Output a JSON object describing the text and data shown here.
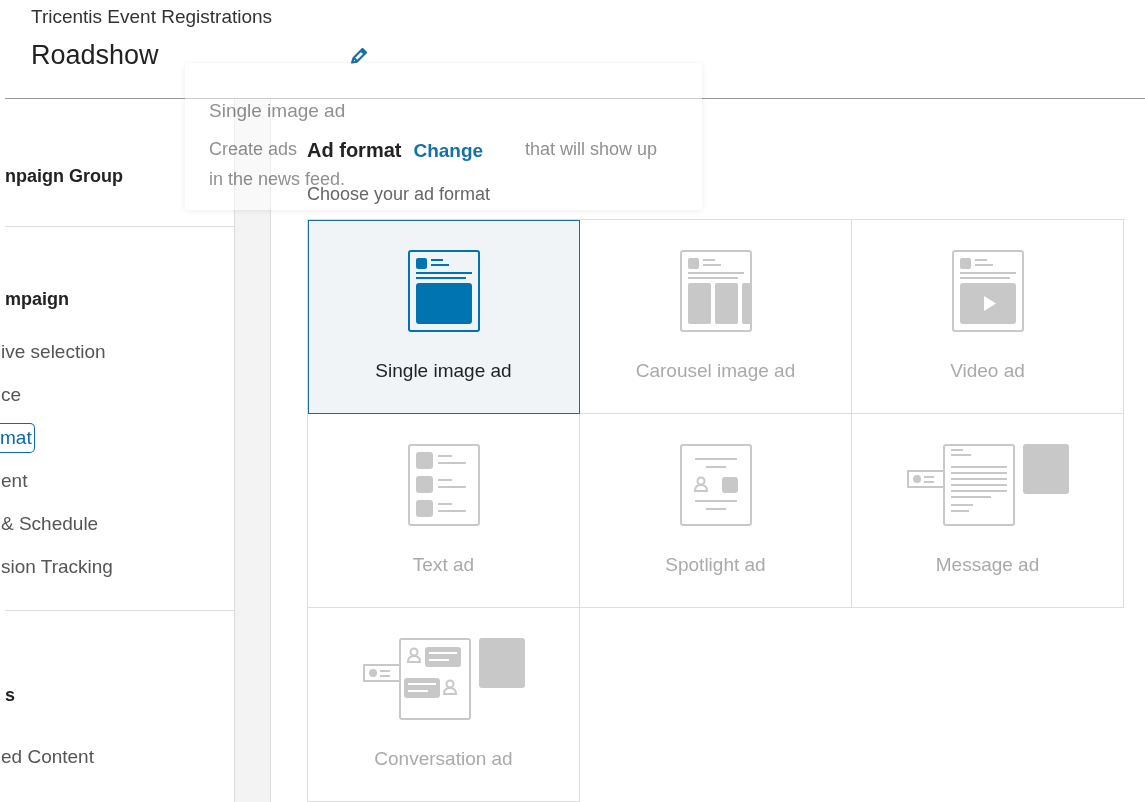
{
  "header": {
    "account": "Tricentis Event Registrations",
    "campaign_name": "Roadshow"
  },
  "tooltip": {
    "title": "Single image ad",
    "text_lines": [
      [
        "Create ads",
        "that will show up"
      ],
      [
        "in the news feed."
      ]
    ]
  },
  "sidebar": {
    "sections": [
      {
        "heading": "npaign Group"
      },
      {
        "heading": "mpaign",
        "items": [
          {
            "label": "ive selection",
            "selected": false
          },
          {
            "label": "ce",
            "selected": false
          },
          {
            "label": "mat",
            "selected": true
          },
          {
            "label": "ent",
            "selected": false
          },
          {
            "label": "& Schedule",
            "selected": false
          },
          {
            "label": "sion Tracking",
            "selected": false
          }
        ]
      },
      {
        "heading": "s",
        "items": [
          {
            "label": "ed Content",
            "selected": false
          }
        ]
      }
    ]
  },
  "main": {
    "heading": "Ad format",
    "change_link": "Change",
    "subheading": "Choose your ad format",
    "formats": [
      {
        "label": "Single image ad",
        "kind": "single",
        "selected": true
      },
      {
        "label": "Carousel image ad",
        "kind": "carousel",
        "selected": false
      },
      {
        "label": "Video ad",
        "kind": "video",
        "selected": false
      },
      {
        "label": "Text ad",
        "kind": "text",
        "selected": false
      },
      {
        "label": "Spotlight ad",
        "kind": "spotlight",
        "selected": false
      },
      {
        "label": "Message ad",
        "kind": "message",
        "selected": false
      },
      {
        "label": "Conversation ad",
        "kind": "conversation",
        "selected": false
      }
    ]
  }
}
